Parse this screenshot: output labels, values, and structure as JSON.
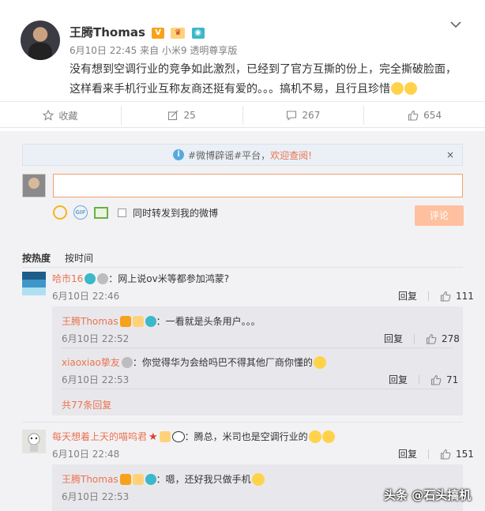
{
  "post": {
    "author": "王腾Thomas",
    "meta": "6月10日 22:45 来自 小米9 透明尊享版",
    "content_line1": "没有想到空调行业的竞争如此激烈，已经到了官方互撕的份上，完全撕破脸面，",
    "content_line2": "这样看来手机行业互称友商还挺有爱的。。。搞机不易，且行且珍惜",
    "actions": {
      "favorite_label": "收藏",
      "repost_count": "25",
      "comment_count": "267",
      "like_count": "654"
    }
  },
  "composer": {
    "notice_prefix": "#微博辟谣#平台，",
    "notice_highlight": "欢迎查阅!",
    "notice_close": "×",
    "also_repost_label": "同时转发到我的微博",
    "submit_label": "评论",
    "gif_label": "GIF"
  },
  "sort": {
    "by_hot": "按热度",
    "by_time": "按时间"
  },
  "comments": [
    {
      "name": "哈市16",
      "text": "：网上说ov米等都参加鸿蒙?",
      "time": "6月10日 22:46",
      "reply_label": "回复",
      "likes": "111",
      "replies": [
        {
          "name": "王腾Thomas",
          "text": "：一看就是头条用户。。。",
          "time": "6月10日 22:52",
          "reply_label": "回复",
          "likes": "278"
        },
        {
          "name": "xiaoxiao挚友",
          "text": "：你觉得华为会给吗巴不得其他厂商你懂的",
          "time": "6月10日 22:53",
          "reply_label": "回复",
          "likes": "71"
        }
      ],
      "more_replies": "共77条回复"
    },
    {
      "name": "每天想着上天的喵呜君",
      "text": "：腾总，米司也是空调行业的",
      "time": "6月10日 22:48",
      "reply_label": "回复",
      "likes": "151",
      "replies": [
        {
          "name": "王腾Thomas",
          "text": "：嗯，还好我只做手机",
          "time": "6月10日 22:53"
        }
      ]
    }
  ],
  "watermark": "头条 @石头搞机",
  "colors": {
    "accent_orange": "#eb7350",
    "submit_disabled": "#ffc09f",
    "comment_bg": "#f2f2f5",
    "reply_bg": "#e8e8ec"
  },
  "icons": {
    "favorite": "star-icon",
    "repost": "repost-icon",
    "comment": "comment-icon",
    "like": "thumbs-up-icon",
    "menu": "chevron-down-icon"
  }
}
